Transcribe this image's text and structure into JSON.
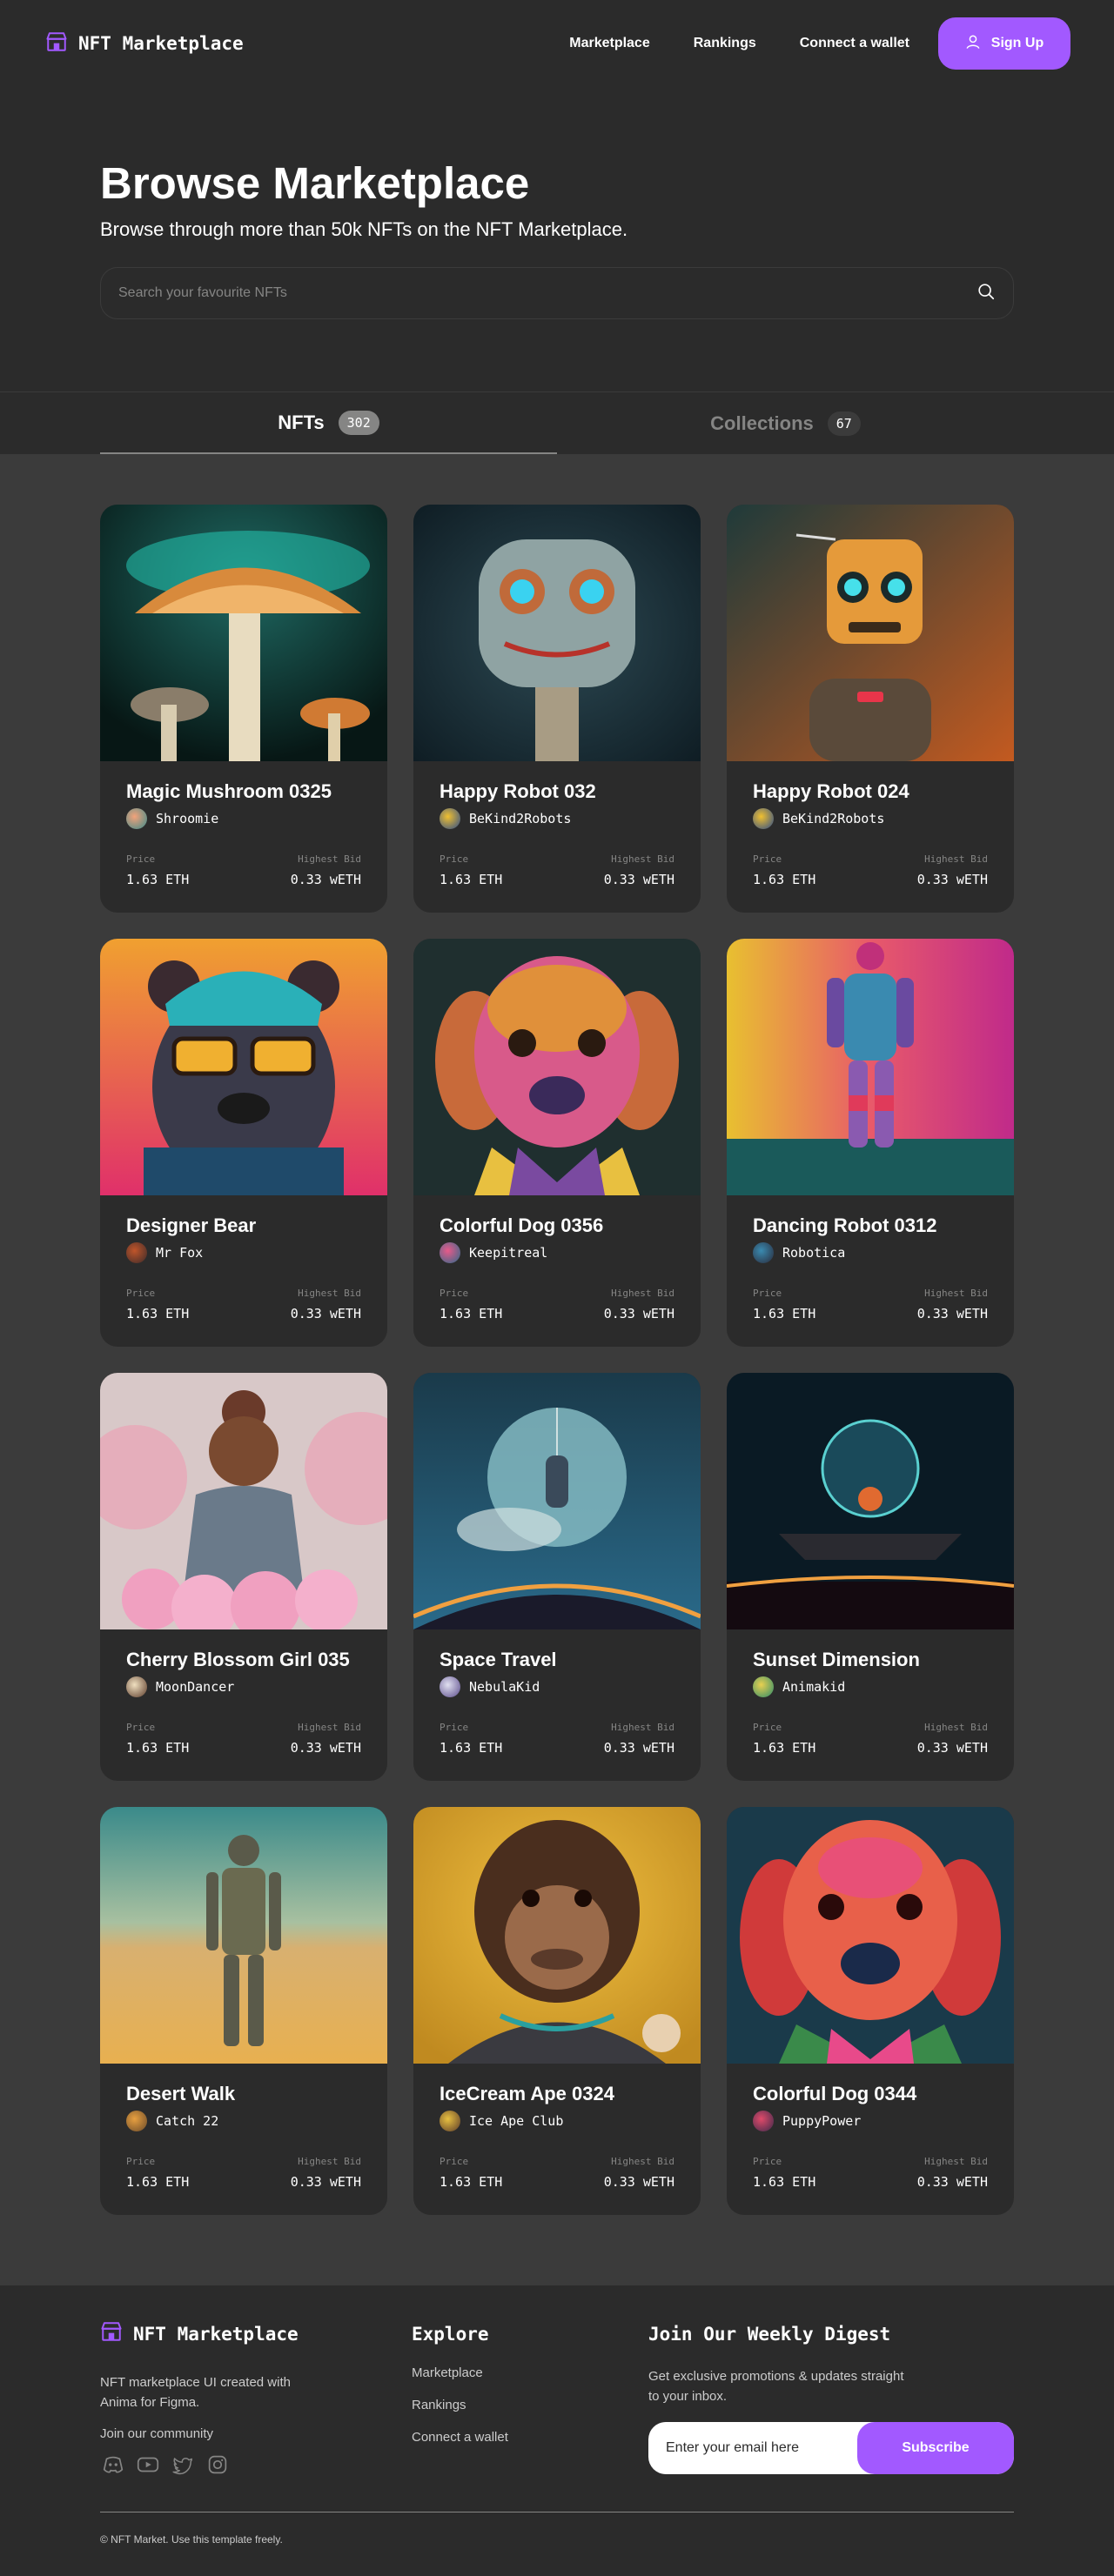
{
  "nav": {
    "brand": "NFT Marketplace",
    "links": [
      "Marketplace",
      "Rankings",
      "Connect a wallet"
    ],
    "signup": "Sign Up"
  },
  "hero": {
    "title": "Browse Marketplace",
    "subtitle": "Browse through more than 50k NFTs on the NFT Marketplace.",
    "search_placeholder": "Search your favourite NFTs"
  },
  "tabs": [
    {
      "label": "NFTs",
      "count": "302"
    },
    {
      "label": "Collections",
      "count": "67"
    }
  ],
  "cards": [
    {
      "title": "Magic Mushroom 0325",
      "artist": "Shroomie",
      "price_label": "Price",
      "price": "1.63 ETH",
      "bid_label": "Highest Bid",
      "bid": "0.33 wETH"
    },
    {
      "title": "Happy Robot 032",
      "artist": "BeKind2Robots",
      "price_label": "Price",
      "price": "1.63 ETH",
      "bid_label": "Highest Bid",
      "bid": "0.33 wETH"
    },
    {
      "title": "Happy Robot 024",
      "artist": "BeKind2Robots",
      "price_label": "Price",
      "price": "1.63 ETH",
      "bid_label": "Highest Bid",
      "bid": "0.33 wETH"
    },
    {
      "title": "Designer Bear",
      "artist": "Mr Fox",
      "price_label": "Price",
      "price": "1.63 ETH",
      "bid_label": "Highest Bid",
      "bid": "0.33 wETH"
    },
    {
      "title": "Colorful Dog 0356",
      "artist": "Keepitreal",
      "price_label": "Price",
      "price": "1.63 ETH",
      "bid_label": "Highest Bid",
      "bid": "0.33 wETH"
    },
    {
      "title": "Dancing Robot 0312",
      "artist": "Robotica",
      "price_label": "Price",
      "price": "1.63 ETH",
      "bid_label": "Highest Bid",
      "bid": "0.33 wETH"
    },
    {
      "title": "Cherry Blossom Girl 035",
      "artist": "MoonDancer",
      "price_label": "Price",
      "price": "1.63 ETH",
      "bid_label": "Highest Bid",
      "bid": "0.33 wETH"
    },
    {
      "title": "Space Travel",
      "artist": "NebulaKid",
      "price_label": "Price",
      "price": "1.63 ETH",
      "bid_label": "Highest Bid",
      "bid": "0.33 wETH"
    },
    {
      "title": "Sunset Dimension",
      "artist": "Animakid",
      "price_label": "Price",
      "price": "1.63 ETH",
      "bid_label": "Highest Bid",
      "bid": "0.33 wETH"
    },
    {
      "title": "Desert Walk",
      "artist": "Catch 22",
      "price_label": "Price",
      "price": "1.63 ETH",
      "bid_label": "Highest Bid",
      "bid": "0.33 wETH"
    },
    {
      "title": "IceCream Ape 0324",
      "artist": "Ice Ape Club",
      "price_label": "Price",
      "price": "1.63 ETH",
      "bid_label": "Highest Bid",
      "bid": "0.33 wETH"
    },
    {
      "title": "Colorful Dog 0344",
      "artist": "PuppyPower",
      "price_label": "Price",
      "price": "1.63 ETH",
      "bid_label": "Highest Bid",
      "bid": "0.33 wETH"
    }
  ],
  "footer": {
    "brand": "NFT Marketplace",
    "description": "NFT marketplace UI created with Anima for Figma.",
    "community": "Join our community",
    "explore_heading": "Explore",
    "explore_links": [
      "Marketplace",
      "Rankings",
      "Connect a wallet"
    ],
    "digest_heading": "Join Our Weekly Digest",
    "digest_text": "Get exclusive promotions & updates straight to your inbox.",
    "email_placeholder": "Enter your email here",
    "subscribe": "Subscribe",
    "copyright": "© NFT Market. Use this template freely."
  },
  "colors": {
    "accent": "#a259ff",
    "background": "#2b2b2b",
    "surface": "#3b3b3b",
    "muted": "#858584"
  }
}
